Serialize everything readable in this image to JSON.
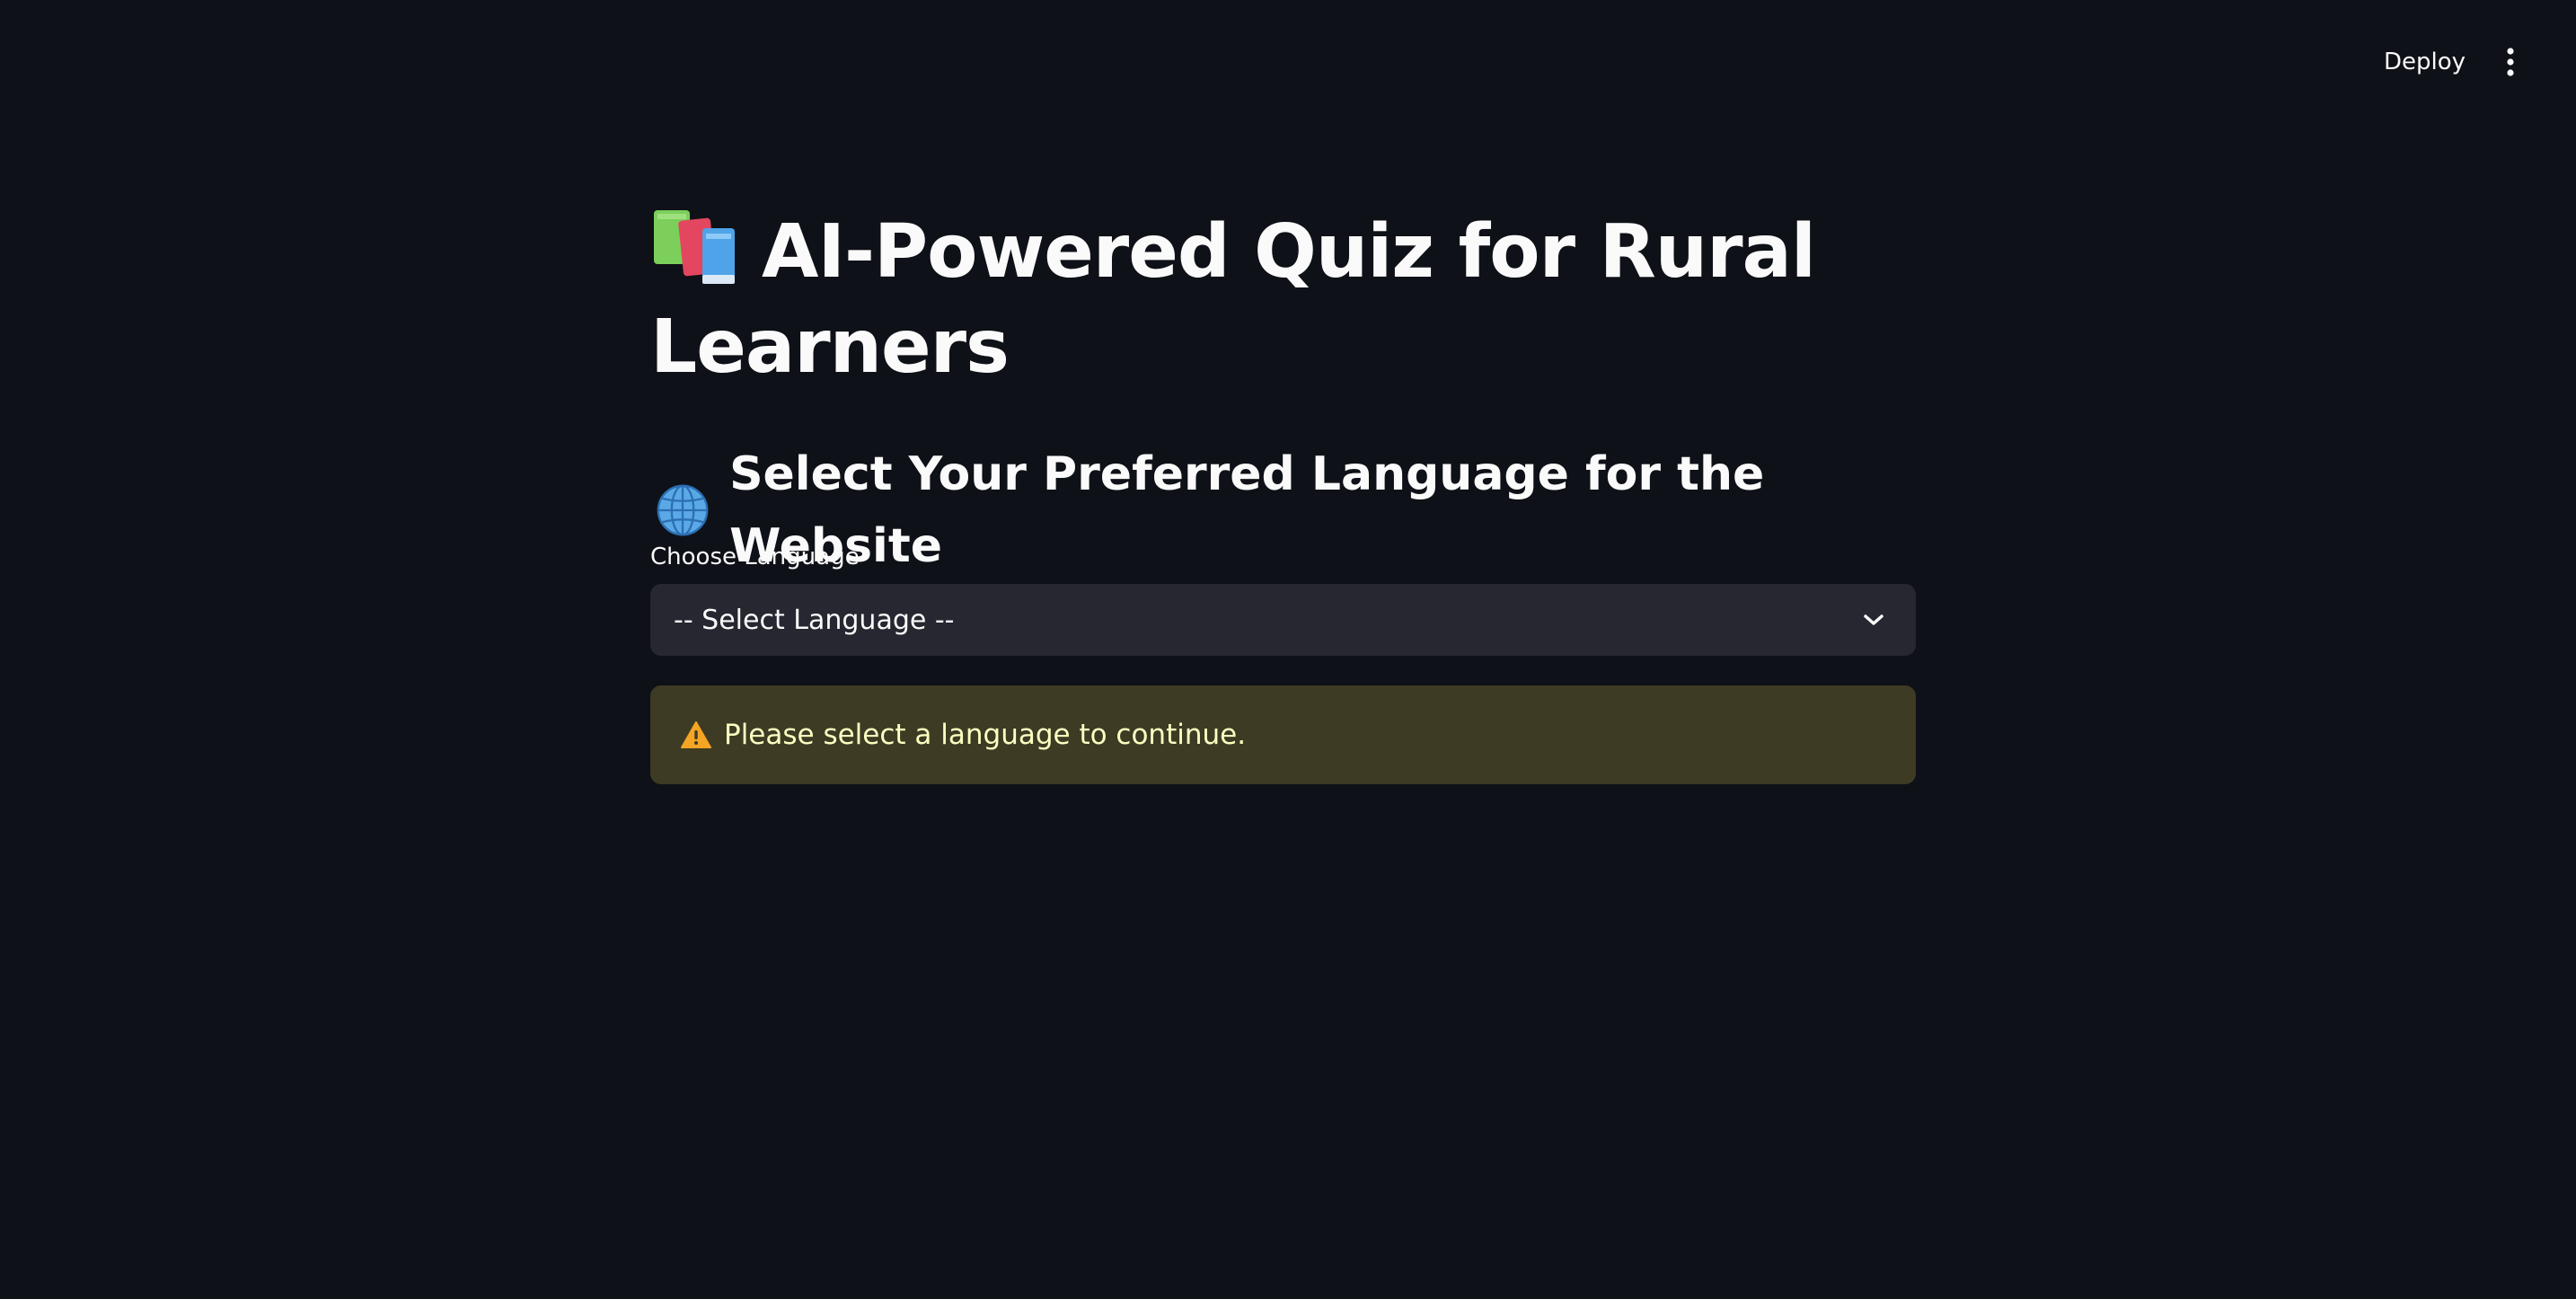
{
  "header": {
    "deploy_label": "Deploy",
    "menu_icon": "more-vertical-icon"
  },
  "main": {
    "title_icon": "books-icon",
    "title": "AI-Powered Quiz for Rural Learners",
    "subtitle_icon": "globe-icon",
    "subtitle": "Select Your Preferred Language for the Website",
    "language_select": {
      "label": "Choose Language",
      "value": "-- Select Language --",
      "icon": "chevron-down-icon"
    },
    "warning": {
      "icon": "warning-icon",
      "text": "Please select a language to continue."
    }
  },
  "colors": {
    "background": "#0e1117",
    "select_background": "#262730",
    "warning_background": "#3d3b23",
    "warning_text": "#ffffc2",
    "text": "#fafafa"
  }
}
